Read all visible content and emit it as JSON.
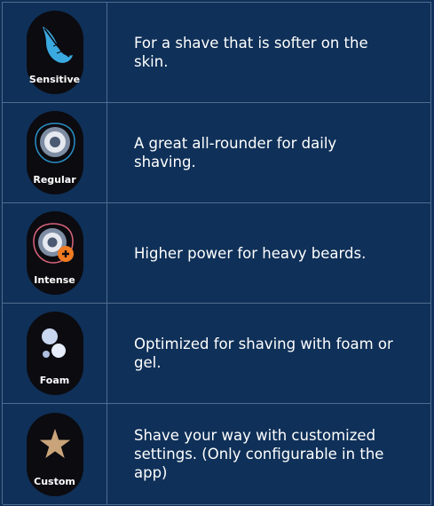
{
  "modes": [
    {
      "label": "Sensitive",
      "icon": "feather-icon",
      "description": "For a shave that is softer on the skin."
    },
    {
      "label": "Regular",
      "icon": "regular-mode-icon",
      "description": "A great all-rounder for daily shaving."
    },
    {
      "label": "Intense",
      "icon": "intense-mode-icon",
      "description": "Higher power for heavy beards."
    },
    {
      "label": "Foam",
      "icon": "foam-bubbles-icon",
      "description": "Optimized for shaving with foam or gel."
    },
    {
      "label": "Custom",
      "icon": "star-icon",
      "description": "Shave your way with customized settings. (Only configurable in the app)"
    }
  ],
  "colors": {
    "background": "#0f3058",
    "grid_line": "#4f6d8f",
    "badge": "#0b0b10",
    "feather": "#3aa9e0",
    "ring": "#7e8da3",
    "plus": "#f07b22",
    "star": "#c9a47a"
  }
}
